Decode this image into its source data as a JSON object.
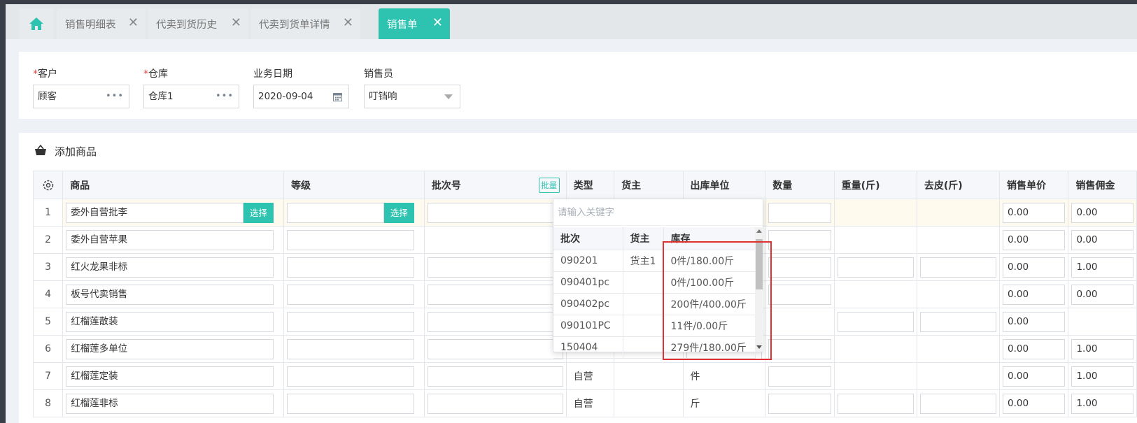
{
  "tabs": [
    {
      "label": "销售明细表",
      "close": "✕"
    },
    {
      "label": "代卖到货历史",
      "close": "✕"
    },
    {
      "label": "代卖到货单详情",
      "close": "✕"
    },
    {
      "label": "销售单",
      "close": "✕"
    }
  ],
  "form": {
    "customer_label": "客户",
    "customer_value": "顾客",
    "warehouse_label": "仓库",
    "warehouse_value": "仓库1",
    "date_label": "业务日期",
    "date_value": "2020-09-04",
    "salesman_label": "销售员",
    "salesman_value": "叮铛响",
    "required_mark": "*",
    "dots": "•••"
  },
  "section": {
    "title": "添加商品"
  },
  "table": {
    "headers": {
      "product": "商品",
      "grade": "等级",
      "batch": "批次号",
      "batch_btn": "批量",
      "type": "类型",
      "owner": "货主",
      "unit": "出库单位",
      "qty": "数量",
      "weight": "重量(斤)",
      "tare": "去皮(斤)",
      "price": "销售单价",
      "commission": "销售佣金"
    },
    "select_label": "选择",
    "rows": [
      {
        "idx": "1",
        "product": "委外自营批李",
        "type": "",
        "unit": "",
        "price": "0.00",
        "commission": "0.00"
      },
      {
        "idx": "2",
        "product": "委外自营苹果",
        "type": "",
        "unit": "",
        "price": "0.00",
        "commission": "0.00"
      },
      {
        "idx": "3",
        "product": "红火龙果非标",
        "type": "",
        "unit": "",
        "price": "0.00",
        "commission": "1.00"
      },
      {
        "idx": "4",
        "product": "板号代卖销售",
        "type": "",
        "unit": "",
        "price": "0.00",
        "commission": "0.00"
      },
      {
        "idx": "5",
        "product": "红榴莲散装",
        "type": "",
        "unit": "",
        "price": "0.00",
        "commission": ""
      },
      {
        "idx": "6",
        "product": "红榴莲多单位",
        "type": "",
        "unit": "",
        "price": "0.00",
        "commission": "1.00"
      },
      {
        "idx": "7",
        "product": "红榴莲定装",
        "type": "自营",
        "unit": "件",
        "price": "0.00",
        "commission": "1.00"
      },
      {
        "idx": "8",
        "product": "红榴莲非标",
        "type": "自营",
        "unit": "斤",
        "price": "0.00",
        "commission": "1.00"
      }
    ]
  },
  "popup": {
    "placeholder": "请输入关键字",
    "headers": {
      "batch": "批次",
      "owner": "货主",
      "stock": "库存"
    },
    "rows": [
      {
        "batch": "090201",
        "owner": "货主1",
        "stock": "0件/180.00斤"
      },
      {
        "batch": "090401pc",
        "owner": "",
        "stock": "0件/100.00斤"
      },
      {
        "batch": "090402pc",
        "owner": "",
        "stock": "200件/400.00斤"
      },
      {
        "batch": "090101PC",
        "owner": "",
        "stock": "11件/0.00斤"
      },
      {
        "batch": "150404",
        "owner": "",
        "stock": "279件/180.00斤"
      }
    ]
  },
  "colors": {
    "accent": "#2ec3b0",
    "highlight": "#e0302f",
    "row_highlight": "#fefbee"
  }
}
